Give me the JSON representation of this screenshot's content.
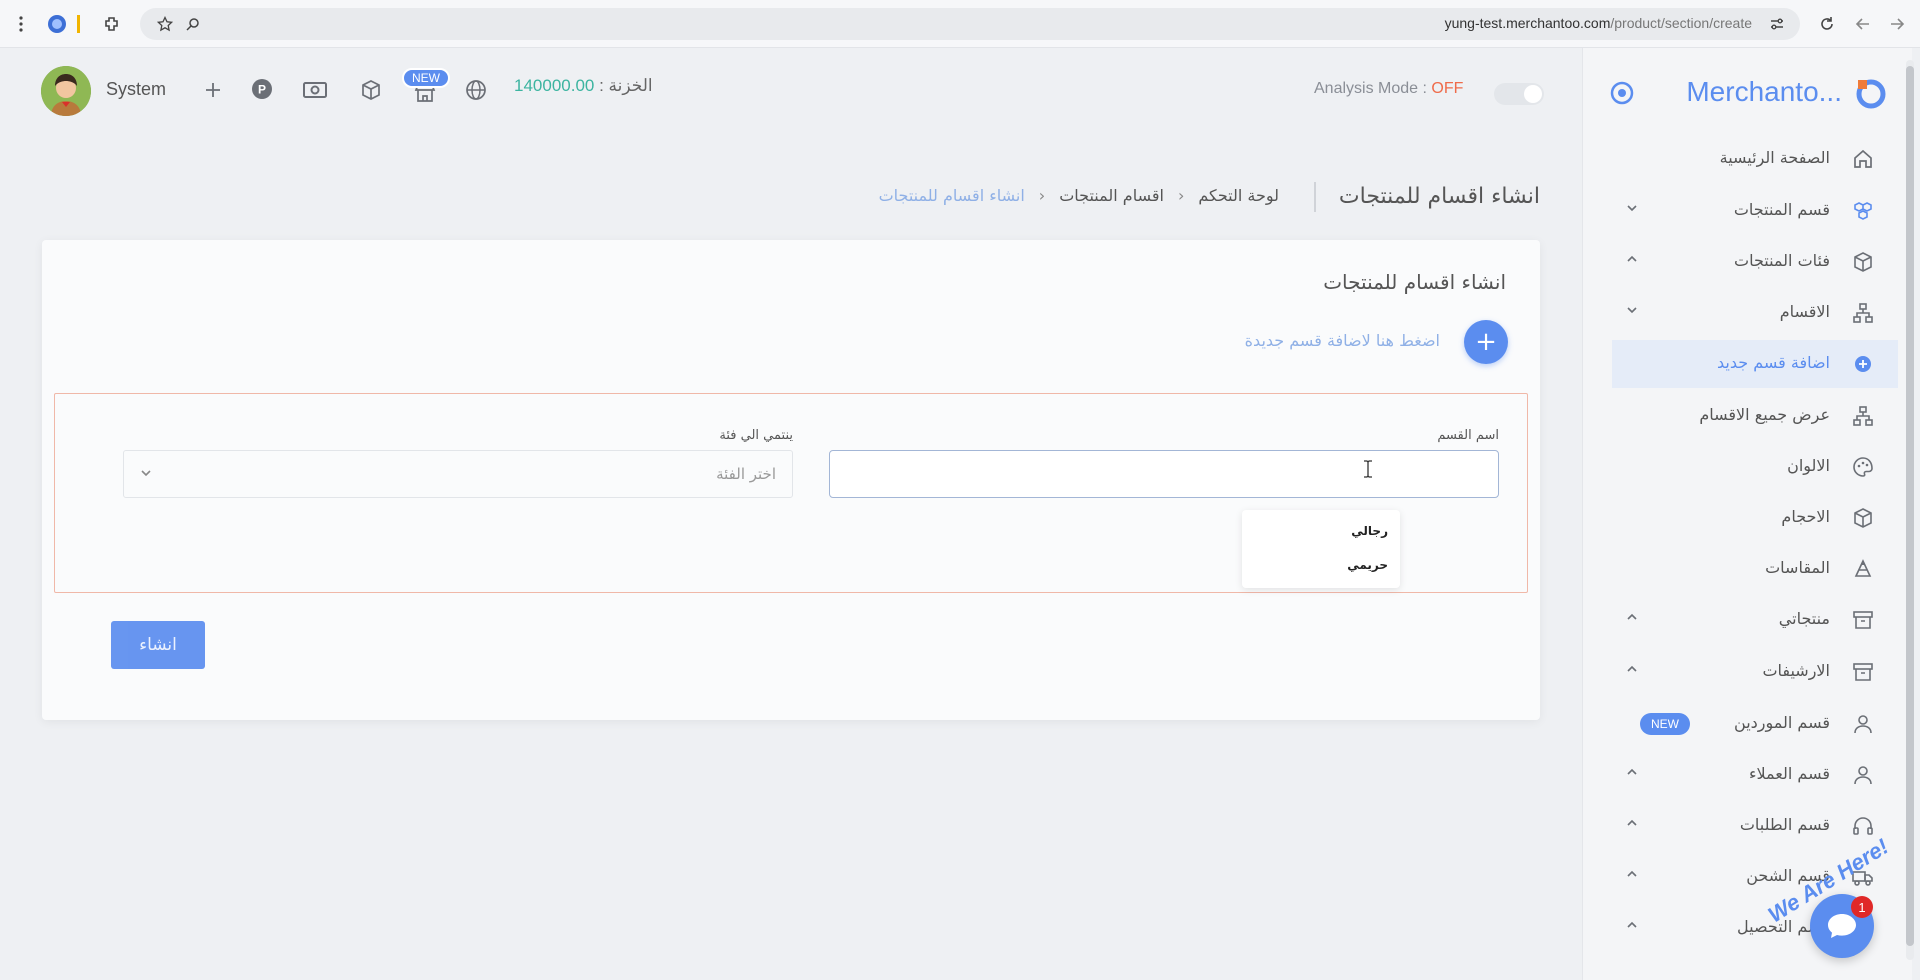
{
  "browser": {
    "url_domain": "yung-test.merchantoo.com",
    "url_path": "/product/section/create"
  },
  "header": {
    "user_name": "System",
    "new_badge": "NEW",
    "treasury_label": "الخزنة :",
    "treasury_amount": "140000.00",
    "analysis_label": "Analysis Mode : ",
    "analysis_state": "OFF"
  },
  "breadcrumb": {
    "page_title": "انشاء اقسام للمنتجات",
    "items": [
      "لوحة التحكم",
      "اقسام المنتجات",
      "انشاء اقسام للمنتجات"
    ],
    "sep": "‹"
  },
  "card": {
    "title": "انشاء اقسام للمنتجات",
    "add_link": "اضغط هنا لاضافة قسم جديدة",
    "add_symbol": "+",
    "section_name_label": "اسم القسم",
    "section_name_value": "",
    "category_label": "ينتمي الي فئة",
    "category_placeholder": "اختر الفئة",
    "suggestions": [
      "رجالي",
      "حريمي"
    ],
    "create_button": "انشاء"
  },
  "sidebar": {
    "brand": "Merchanto...",
    "items": [
      {
        "label": "الصفحة الرئيسية",
        "icon": "home-icon"
      },
      {
        "label": "قسم المنتجات",
        "icon": "cubes-icon"
      },
      {
        "label": "فئات المنتجات",
        "icon": "box-icon"
      },
      {
        "label": "الاقسام",
        "icon": "sitemap-icon"
      },
      {
        "label": "اضافة قسم جديد",
        "icon": "plus-circle-icon"
      },
      {
        "label": "عرض جميع الاقسام",
        "icon": "sitemap-icon"
      },
      {
        "label": "الالوان",
        "icon": "palette-icon"
      },
      {
        "label": "الاحجام",
        "icon": "box-icon"
      },
      {
        "label": "المقاسات",
        "icon": "ruler-icon"
      },
      {
        "label": "منتجاتي",
        "icon": "archive-icon"
      },
      {
        "label": "الارشيفات",
        "icon": "archive-icon"
      },
      {
        "label": "قسم الموردين",
        "icon": "user-icon",
        "badge": "NEW"
      },
      {
        "label": "قسم العملاء",
        "icon": "user-icon"
      },
      {
        "label": "قسم الطلبات",
        "icon": "headset-icon"
      },
      {
        "label": "قسم الشحن",
        "icon": "truck-icon"
      },
      {
        "label": "قسم التحصيل",
        "icon": "wallet-icon"
      }
    ]
  },
  "chat": {
    "badge_count": "1",
    "tagline": "We Are Here!"
  },
  "colors": {
    "accent": "#5b8def",
    "treasury_amount": "#3cb4a0",
    "off": "#ef6b4a",
    "form_border": "#f0b8a8"
  }
}
